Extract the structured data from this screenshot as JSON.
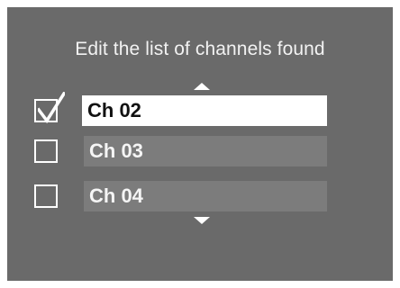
{
  "screen": {
    "title": "Edit the list of channels found",
    "scroll_up_icon": "triangle-up-icon",
    "scroll_down_icon": "triangle-down-icon"
  },
  "channels": [
    {
      "label": "Ch 02",
      "checked": true,
      "selected": true
    },
    {
      "label": "Ch 03",
      "checked": false,
      "selected": false
    },
    {
      "label": "Ch 04",
      "checked": false,
      "selected": false
    }
  ],
  "colors": {
    "screen_background": "#6a6a6a",
    "field_background": "#7c7c7c",
    "selected_field_background": "#ffffff",
    "text": "#f2f2f2",
    "selected_text": "#111111"
  }
}
